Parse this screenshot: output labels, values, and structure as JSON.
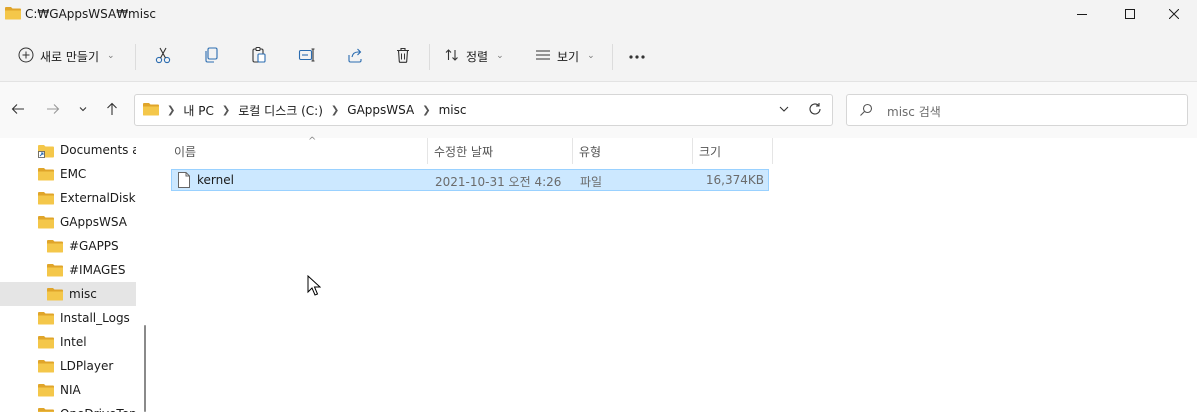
{
  "window": {
    "title": "C:₩GAppsWSA₩misc",
    "controls": [
      "minimize-icon",
      "maximize-icon",
      "close-icon"
    ]
  },
  "toolbar": {
    "new_label": "새로 만들기",
    "sort_label": "정렬",
    "view_label": "보기",
    "icons": [
      "cut-icon",
      "copy-icon",
      "paste-icon",
      "rename-icon",
      "share-icon",
      "delete-icon",
      "more-icon"
    ]
  },
  "nav": {
    "back": "back-arrow-icon",
    "forward": "forward-arrow-icon",
    "recent": "chevron-down-icon",
    "up": "up-arrow-icon"
  },
  "address": {
    "crumbs": [
      "내 PC",
      "로컬 디스크 (C:)",
      "GAppsWSA",
      "misc"
    ]
  },
  "search": {
    "placeholder": "misc 검색"
  },
  "sidebar": {
    "items": [
      {
        "label": "Documents and Settings",
        "indent": 1,
        "shortcut": true
      },
      {
        "label": "EMC",
        "indent": 1
      },
      {
        "label": "ExternalDisk",
        "indent": 1
      },
      {
        "label": "GAppsWSA",
        "indent": 1
      },
      {
        "label": "#GAPPS",
        "indent": 2
      },
      {
        "label": "#IMAGES",
        "indent": 2
      },
      {
        "label": "misc",
        "indent": 2,
        "selected": true
      },
      {
        "label": "Install_Logs",
        "indent": 1
      },
      {
        "label": "Intel",
        "indent": 1
      },
      {
        "label": "LDPlayer",
        "indent": 1
      },
      {
        "label": "NIA",
        "indent": 1
      },
      {
        "label": "OneDriveTemp",
        "indent": 1
      }
    ]
  },
  "columns": {
    "name": "이름",
    "date": "수정한 날짜",
    "type": "유형",
    "size": "크기"
  },
  "files": [
    {
      "name": "kernel",
      "date": "2021-10-31 오전 4:26",
      "type": "파일",
      "size": "16,374KB",
      "selected": true
    }
  ],
  "colors": {
    "chrome": "#f3f3f3",
    "selection": "#cce8ff",
    "selection_border": "#99d1ff",
    "folder": "#f4c74a",
    "folder_dark": "#e0a52a"
  }
}
